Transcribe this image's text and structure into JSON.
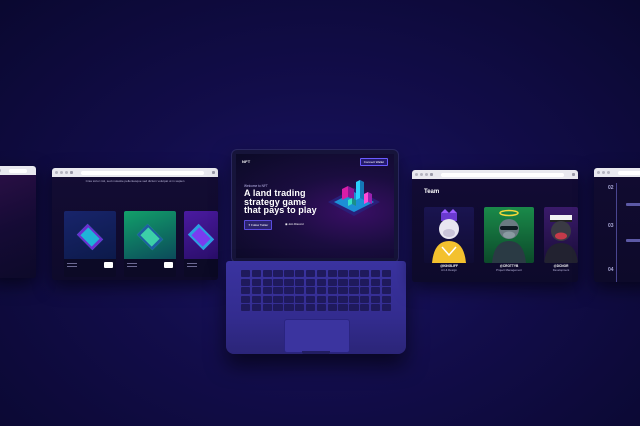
{
  "gallery_window": {
    "caption": "Cras tortor nisl, sed molestie pellentesque sed dictum volutpat ut in sapien",
    "cards": [
      {
        "art": "isometric-city-blue",
        "stat_a": "120",
        "stat_b": "450"
      },
      {
        "art": "isometric-city-green",
        "stat_a": "84",
        "stat_b": "300"
      },
      {
        "art": "isometric-city-purple",
        "stat_a": "96",
        "stat_b": "380"
      }
    ]
  },
  "laptop": {
    "logo": "NFT",
    "connect_button": "Connect Wallet",
    "welcome": "Welcome to NFT",
    "headline": "A land trading strategy game that pays to play",
    "cta_primary": "Follow Twitter",
    "cta_secondary": "Join Discord"
  },
  "team_window": {
    "title": "Team",
    "members": [
      {
        "handle": "@KINGLIFF",
        "role": "Art & Design"
      },
      {
        "handle": "@CROTTYB",
        "role": "Project Management"
      },
      {
        "handle": "@DCNOR",
        "role": "Development"
      }
    ]
  },
  "roadmap_window": {
    "steps": [
      "02",
      "03",
      "04"
    ]
  },
  "colors": {
    "background": "#120d4a",
    "laptop_body": "#3a33a0",
    "accent": "#6a5cff"
  }
}
